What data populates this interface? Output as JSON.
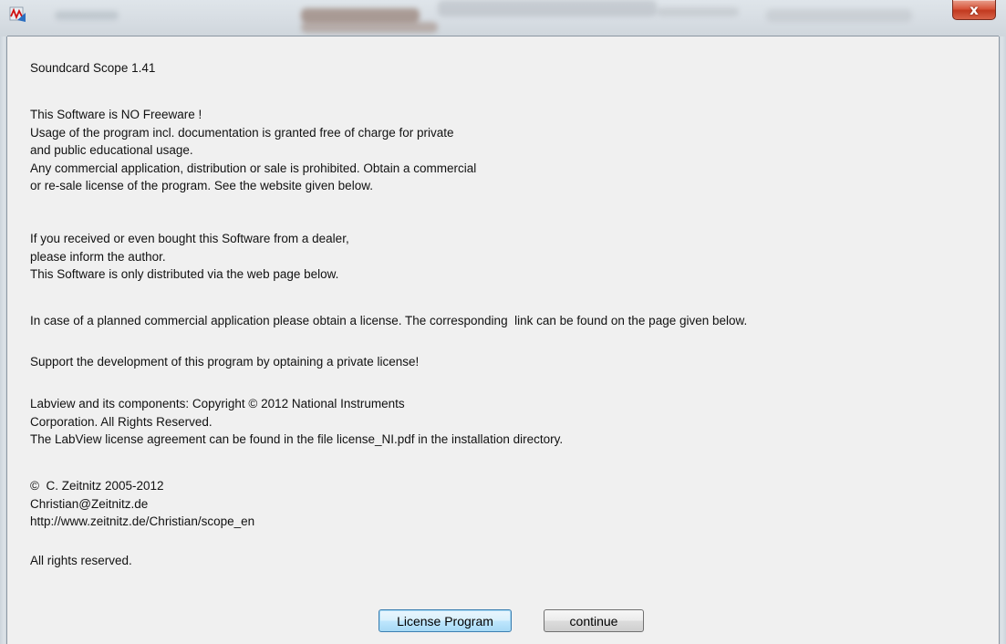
{
  "window": {
    "close_label": "x"
  },
  "message": {
    "title": "Soundcard Scope 1.41",
    "p1": [
      "This Software is NO Freeware !",
      "Usage of the program incl. documentation is granted free of charge for private",
      "and public educational usage.",
      "Any commercial application, distribution or sale is prohibited. Obtain a commercial",
      "or re-sale license of the program. See the website given below."
    ],
    "p2": [
      "If you received or even bought this Software from a dealer,",
      "please inform the author.",
      "This Software is only distributed via the web page below."
    ],
    "p3": "In case of a planned commercial application please obtain a license. The corresponding  link can be found on the page given below.",
    "p4": "Support the development of this program by optaining a private license!",
    "p5": [
      "Labview and its components: Copyright © 2012 National Instruments",
      "Corporation. All Rights Reserved.",
      "The LabView license agreement can be found in the file license_NI.pdf in the installation directory."
    ],
    "p6": [
      "©  C. Zeitnitz 2005-2012",
      "Christian@Zeitnitz.de",
      "http://www.zeitnitz.de/Christian/scope_en"
    ],
    "p7": "All rights reserved."
  },
  "buttons": {
    "license": "License Program",
    "continue": "continue"
  },
  "icons": {
    "app": "scope-app-icon",
    "close": "close-icon"
  },
  "colors": {
    "background": "#f0f0f0",
    "close_button": "#c9462b",
    "default_button_border": "#3c7fb1"
  }
}
